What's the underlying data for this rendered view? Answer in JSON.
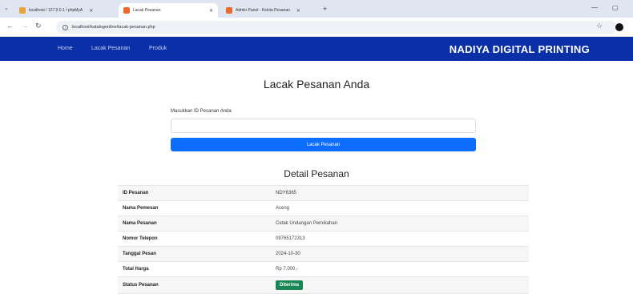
{
  "browser": {
    "tabs": [
      {
        "title": "localhost / 127.0.0.1 / phpMyA",
        "color": "#e8a33d"
      },
      {
        "title": "Lacak Pesanan",
        "color": "#e86a2c"
      },
      {
        "title": "Admin Panel - Kelola Pesanan",
        "color": "#e86a2c"
      }
    ],
    "url": "localhost/katalogonline/lacak-pesanan.php"
  },
  "navbar": {
    "links": [
      "Home",
      "Lacak Pesanan",
      "Produk"
    ],
    "brand": "NADIYA DIGITAL PRINTING",
    "color": "#0a2fa7"
  },
  "page": {
    "title": "Lacak Pesanan Anda",
    "id_label": "Masukkan ID Pesanan Anda",
    "id_value": "",
    "track_button": "Lacak Pesanan",
    "detail_title": "Detail Pesanan"
  },
  "details": [
    {
      "label": "ID Pesanan",
      "value": "NDY6365"
    },
    {
      "label": "Nama Pemesan",
      "value": "Aceng"
    },
    {
      "label": "Nama Pesanan",
      "value": "Cetak Undangan Pernikahan"
    },
    {
      "label": "Nomor Telepon",
      "value": "09765172313"
    },
    {
      "label": "Tanggal Pesan",
      "value": "2024-10-30"
    },
    {
      "label": "Total Harga",
      "value": "Rp 7.000,-"
    },
    {
      "label": "Status Pesanan",
      "value": "Diterima"
    }
  ],
  "colors": {
    "accent": "#0d6efd",
    "status_success": "#198754"
  }
}
